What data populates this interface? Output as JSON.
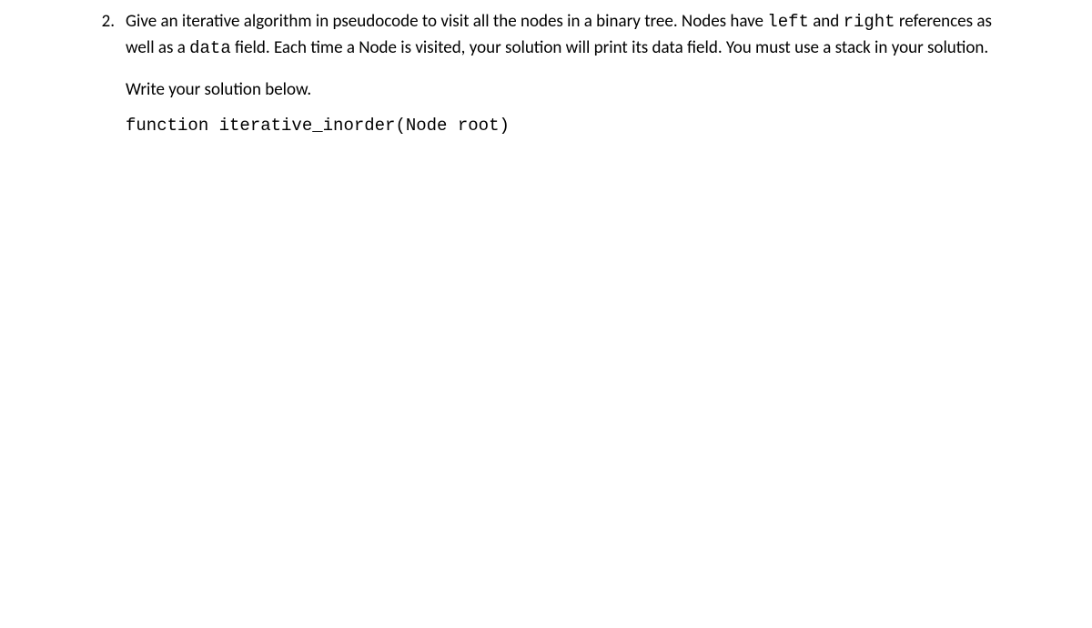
{
  "question": {
    "number": "2.",
    "text_parts": {
      "p1_a": "Give an iterative algorithm in pseudocode to visit all the nodes in a binary tree. Nodes have ",
      "code1": "left",
      "p1_b": " and ",
      "code2": "right",
      "p1_c": " references as well as a ",
      "code3": "data",
      "p1_d": " field. Each time a Node is visited, your solution will print its data field. You must use a stack in your solution."
    },
    "instruction": "Write your solution below.",
    "signature": "function iterative_inorder(Node root)"
  }
}
